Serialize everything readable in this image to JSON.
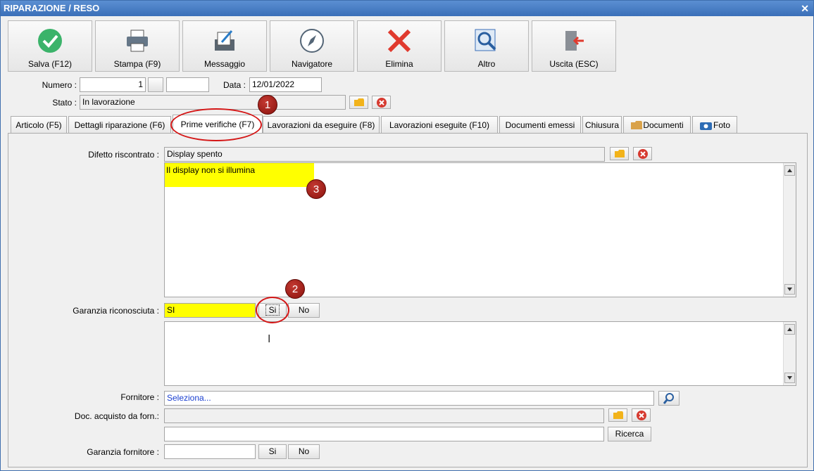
{
  "window": {
    "title": "RIPARAZIONE / RESO",
    "close_icon": "close-icon"
  },
  "toolbar": [
    {
      "label": "Salva (F12)",
      "icon": "check-icon"
    },
    {
      "label": "Stampa (F9)",
      "icon": "printer-icon"
    },
    {
      "label": "Messaggio",
      "icon": "message-icon"
    },
    {
      "label": "Navigatore",
      "icon": "compass-icon"
    },
    {
      "label": "Elimina",
      "icon": "delete-x-icon"
    },
    {
      "label": "Altro",
      "icon": "magnifier-icon"
    },
    {
      "label": "Uscita (ESC)",
      "icon": "exit-icon"
    }
  ],
  "header": {
    "numero_label": "Numero :",
    "numero_value": "1",
    "data_label": "Data :",
    "data_value": "12/01/2022",
    "stato_label": "Stato :",
    "stato_value": "In lavorazione"
  },
  "tabs": [
    {
      "label": "Articolo (F5)"
    },
    {
      "label": "Dettagli riparazione (F6)"
    },
    {
      "label": "Prime verifiche (F7)",
      "active": true
    },
    {
      "label": "Lavorazioni da eseguire (F8)"
    },
    {
      "label": "Lavorazioni eseguite  (F10)"
    },
    {
      "label": "Documenti emessi"
    },
    {
      "label": "Chiusura"
    },
    {
      "label": "Documenti",
      "icon": "folder-icon"
    },
    {
      "label": "Foto",
      "icon": "camera-icon"
    }
  ],
  "form": {
    "difetto_label": "Difetto riscontrato :",
    "difetto_value": "Display spento",
    "difetto_memo": "Il display non si illumina",
    "garanzia_label": "Garanzia riconosciuta :",
    "garanzia_value": "SI",
    "si_label": "Si",
    "no_label": "No",
    "fornitore_label": "Fornitore :",
    "fornitore_value": "Seleziona...",
    "doc_label": "Doc. acquisto da forn.:",
    "ricerca_label": "Ricerca",
    "garanzia_forn_label": "Garanzia fornitore :"
  },
  "annotations": [
    {
      "number": "1"
    },
    {
      "number": "2"
    },
    {
      "number": "3"
    }
  ],
  "colors": {
    "highlight": "#ffff00",
    "annotation_red": "#d41616",
    "titlebar": "#3a6fb8"
  }
}
